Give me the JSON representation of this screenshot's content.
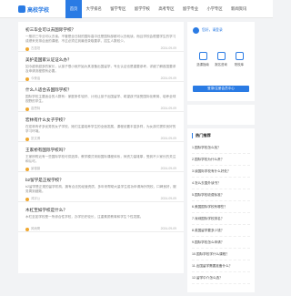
{
  "brand": {
    "name": "高校学校",
    "color": "#2a7be4"
  },
  "nav": [
    {
      "label": "首页",
      "active": true
    },
    {
      "label": "大学排名"
    },
    {
      "label": "留学专区"
    },
    {
      "label": "留学学校"
    },
    {
      "label": "高考专区"
    },
    {
      "label": "留学专业"
    },
    {
      "label": "小学专区"
    },
    {
      "label": "新闻资讯"
    }
  ],
  "articles": [
    {
      "title": "初三毕业可以去国际学校？",
      "summary": "一般初三毕业可以去读。不管是全日制的国际高中还是国际部都可以去就读，而且学校会根据学生的学习成绩来安排合适的课程，不过必须达到最低录取要求，招生人数较少。",
      "author": "古墨坦",
      "date": "2024-09-09"
    },
    {
      "title": "美护是国家认证证么办？",
      "summary": "如今越来越多的家长，从孩子很小就开始为其准备出国留学，专业认证也是重要参考，详细了解各国要求及申请流程很有必要。",
      "author": "今夜话",
      "date": "2024-09-09"
    },
    {
      "title": "什么人适合去国际学校？",
      "summary": "国际学校主要适合的人群有：家庭条件较好、计划让孩子出国留学、希望孩子接受国际化教育、培养全球视野的学生。",
      "author": "嘉思特",
      "date": "2024-09-09"
    },
    {
      "title": "宏林有什么女子学校？",
      "summary": "在宏林有许多优秀的女子学校，她们注重培养学生的全面发展，课程设置丰富多样，为女孩们提供良好的学习环境。",
      "author": "凯文博",
      "date": "2024-09-09"
    },
    {
      "title": "王家桥有国际学校吗？",
      "summary": "王家桥附近有一些国际学校可供选择，教学模式采用国际课程体系，师资力量雄厚，受到不少家长的关注和认可。",
      "author": "景德镇",
      "date": "2024-09-09"
    },
    {
      "title": "b2留学是正规学校？",
      "summary": "b2留学是正规的留学机构，拥有合法的经营资质，多年来帮助大量学生成功申请海外院校，口碑良好，服务周到细致。",
      "author": "鸿宇公",
      "date": "2024-09-09"
    },
    {
      "title": "木杠至如学校是什么？",
      "summary": "木杠至如学校是一所综合性学校，办学历史较长，注重素质教育和学生个性发展。",
      "author": "风雨哥",
      "date": "2024-09-09"
    }
  ],
  "sidebar": {
    "greeting": "您好，请登录",
    "quick_links": [
      "选课指南",
      "报名咨询",
      "院校库"
    ],
    "login_button": "登录/注册会员中心",
    "hot_title": "热门推荐",
    "hot_items": [
      "1.国际学校怎么找？",
      "2.国际学校为什么贵？",
      "3.读国际学校有什么好处？",
      "4.怎么去国外读书？",
      "5.国际学校收费标准？",
      "6.美国国际学校有哪些？",
      "7.深圳国际学校排名？",
      "8.英国留学要多少钱？",
      "9.国际学校怎么申请？",
      "10.国际学校学什么课程？",
      "11.出国留学需要准备什么？",
      "12.留学中介怎么选？"
    ]
  }
}
